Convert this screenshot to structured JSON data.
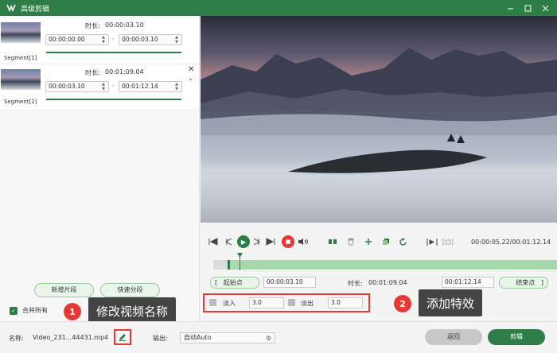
{
  "window": {
    "title": "高级剪辑"
  },
  "segments": [
    {
      "name": "Segment[1]",
      "duration_label": "时长:",
      "duration": "00:00:03.10",
      "start": "00:00:00.00",
      "end": "00:00:03.10"
    },
    {
      "name": "Segment[2]",
      "duration_label": "时长:",
      "duration": "00:01:09.04",
      "start": "00:00:03.10",
      "end": "00:01:12.14"
    }
  ],
  "buttons": {
    "add_segment": "新增片段",
    "quick_split": "快速分段",
    "back": "返回",
    "cut": "剪辑"
  },
  "merge": {
    "label": "合并所有",
    "checked": true
  },
  "player": {
    "current_time": "00:00:05.22/00:01:12.14"
  },
  "range": {
    "start_label": "起始点",
    "start": "00:00:03.10",
    "duration_label": "时长:",
    "duration": "00:01:09.04",
    "end": "00:01:12.14",
    "end_label": "结束点"
  },
  "effects": {
    "fade_in_label": "淡入",
    "fade_in_value": "3.0",
    "fade_out_label": "淡出",
    "fade_out_value": "3.0"
  },
  "callouts": [
    {
      "num": "1",
      "text": "修改视频名称"
    },
    {
      "num": "2",
      "text": "添加特效"
    }
  ],
  "bottom": {
    "name_label": "名称:",
    "filename": "Video_231...44431.mp4",
    "output_label": "输出:",
    "output_value": "自动Auto"
  },
  "colors": {
    "accent": "#2e7d46",
    "alert": "#e53935"
  }
}
